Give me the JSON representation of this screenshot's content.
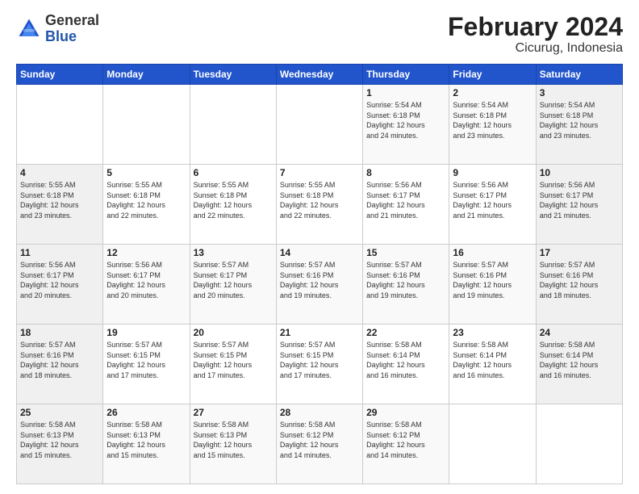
{
  "logo": {
    "text_general": "General",
    "text_blue": "Blue"
  },
  "title": "February 2024",
  "subtitle": "Cicurug, Indonesia",
  "days_of_week": [
    "Sunday",
    "Monday",
    "Tuesday",
    "Wednesday",
    "Thursday",
    "Friday",
    "Saturday"
  ],
  "weeks": [
    [
      {
        "day": "",
        "info": ""
      },
      {
        "day": "",
        "info": ""
      },
      {
        "day": "",
        "info": ""
      },
      {
        "day": "",
        "info": ""
      },
      {
        "day": "1",
        "info": "Sunrise: 5:54 AM\nSunset: 6:18 PM\nDaylight: 12 hours\nand 24 minutes."
      },
      {
        "day": "2",
        "info": "Sunrise: 5:54 AM\nSunset: 6:18 PM\nDaylight: 12 hours\nand 23 minutes."
      },
      {
        "day": "3",
        "info": "Sunrise: 5:54 AM\nSunset: 6:18 PM\nDaylight: 12 hours\nand 23 minutes."
      }
    ],
    [
      {
        "day": "4",
        "info": "Sunrise: 5:55 AM\nSunset: 6:18 PM\nDaylight: 12 hours\nand 23 minutes."
      },
      {
        "day": "5",
        "info": "Sunrise: 5:55 AM\nSunset: 6:18 PM\nDaylight: 12 hours\nand 22 minutes."
      },
      {
        "day": "6",
        "info": "Sunrise: 5:55 AM\nSunset: 6:18 PM\nDaylight: 12 hours\nand 22 minutes."
      },
      {
        "day": "7",
        "info": "Sunrise: 5:55 AM\nSunset: 6:18 PM\nDaylight: 12 hours\nand 22 minutes."
      },
      {
        "day": "8",
        "info": "Sunrise: 5:56 AM\nSunset: 6:17 PM\nDaylight: 12 hours\nand 21 minutes."
      },
      {
        "day": "9",
        "info": "Sunrise: 5:56 AM\nSunset: 6:17 PM\nDaylight: 12 hours\nand 21 minutes."
      },
      {
        "day": "10",
        "info": "Sunrise: 5:56 AM\nSunset: 6:17 PM\nDaylight: 12 hours\nand 21 minutes."
      }
    ],
    [
      {
        "day": "11",
        "info": "Sunrise: 5:56 AM\nSunset: 6:17 PM\nDaylight: 12 hours\nand 20 minutes."
      },
      {
        "day": "12",
        "info": "Sunrise: 5:56 AM\nSunset: 6:17 PM\nDaylight: 12 hours\nand 20 minutes."
      },
      {
        "day": "13",
        "info": "Sunrise: 5:57 AM\nSunset: 6:17 PM\nDaylight: 12 hours\nand 20 minutes."
      },
      {
        "day": "14",
        "info": "Sunrise: 5:57 AM\nSunset: 6:16 PM\nDaylight: 12 hours\nand 19 minutes."
      },
      {
        "day": "15",
        "info": "Sunrise: 5:57 AM\nSunset: 6:16 PM\nDaylight: 12 hours\nand 19 minutes."
      },
      {
        "day": "16",
        "info": "Sunrise: 5:57 AM\nSunset: 6:16 PM\nDaylight: 12 hours\nand 19 minutes."
      },
      {
        "day": "17",
        "info": "Sunrise: 5:57 AM\nSunset: 6:16 PM\nDaylight: 12 hours\nand 18 minutes."
      }
    ],
    [
      {
        "day": "18",
        "info": "Sunrise: 5:57 AM\nSunset: 6:16 PM\nDaylight: 12 hours\nand 18 minutes."
      },
      {
        "day": "19",
        "info": "Sunrise: 5:57 AM\nSunset: 6:15 PM\nDaylight: 12 hours\nand 17 minutes."
      },
      {
        "day": "20",
        "info": "Sunrise: 5:57 AM\nSunset: 6:15 PM\nDaylight: 12 hours\nand 17 minutes."
      },
      {
        "day": "21",
        "info": "Sunrise: 5:57 AM\nSunset: 6:15 PM\nDaylight: 12 hours\nand 17 minutes."
      },
      {
        "day": "22",
        "info": "Sunrise: 5:58 AM\nSunset: 6:14 PM\nDaylight: 12 hours\nand 16 minutes."
      },
      {
        "day": "23",
        "info": "Sunrise: 5:58 AM\nSunset: 6:14 PM\nDaylight: 12 hours\nand 16 minutes."
      },
      {
        "day": "24",
        "info": "Sunrise: 5:58 AM\nSunset: 6:14 PM\nDaylight: 12 hours\nand 16 minutes."
      }
    ],
    [
      {
        "day": "25",
        "info": "Sunrise: 5:58 AM\nSunset: 6:13 PM\nDaylight: 12 hours\nand 15 minutes."
      },
      {
        "day": "26",
        "info": "Sunrise: 5:58 AM\nSunset: 6:13 PM\nDaylight: 12 hours\nand 15 minutes."
      },
      {
        "day": "27",
        "info": "Sunrise: 5:58 AM\nSunset: 6:13 PM\nDaylight: 12 hours\nand 15 minutes."
      },
      {
        "day": "28",
        "info": "Sunrise: 5:58 AM\nSunset: 6:12 PM\nDaylight: 12 hours\nand 14 minutes."
      },
      {
        "day": "29",
        "info": "Sunrise: 5:58 AM\nSunset: 6:12 PM\nDaylight: 12 hours\nand 14 minutes."
      },
      {
        "day": "",
        "info": ""
      },
      {
        "day": "",
        "info": ""
      }
    ]
  ]
}
